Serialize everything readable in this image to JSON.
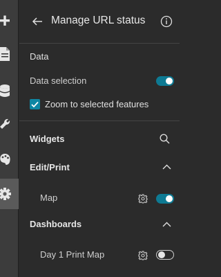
{
  "rail": {
    "items": [
      {
        "icon": "plus-icon"
      },
      {
        "icon": "page-icon"
      },
      {
        "icon": "database-icon"
      },
      {
        "icon": "wrench-icon"
      },
      {
        "icon": "palette-icon"
      },
      {
        "icon": "gear-icon",
        "active": true
      }
    ]
  },
  "header": {
    "title": "Manage URL status"
  },
  "data_section": {
    "heading": "Data",
    "data_selection_label": "Data selection",
    "data_selection_on": true,
    "zoom_label": "Zoom to selected features",
    "zoom_checked": true
  },
  "widgets": {
    "heading": "Widgets",
    "groups": [
      {
        "name": "Edit/Print",
        "expanded": true,
        "items": [
          {
            "label": "Map",
            "on": true
          }
        ]
      },
      {
        "name": "Dashboards",
        "expanded": true,
        "items": [
          {
            "label": "Day 1 Print Map",
            "on": false
          }
        ]
      }
    ]
  },
  "colors": {
    "accent": "#0e7a93",
    "panel_bg": "#2b2b2b",
    "rail_bg": "#3c3c3c"
  }
}
